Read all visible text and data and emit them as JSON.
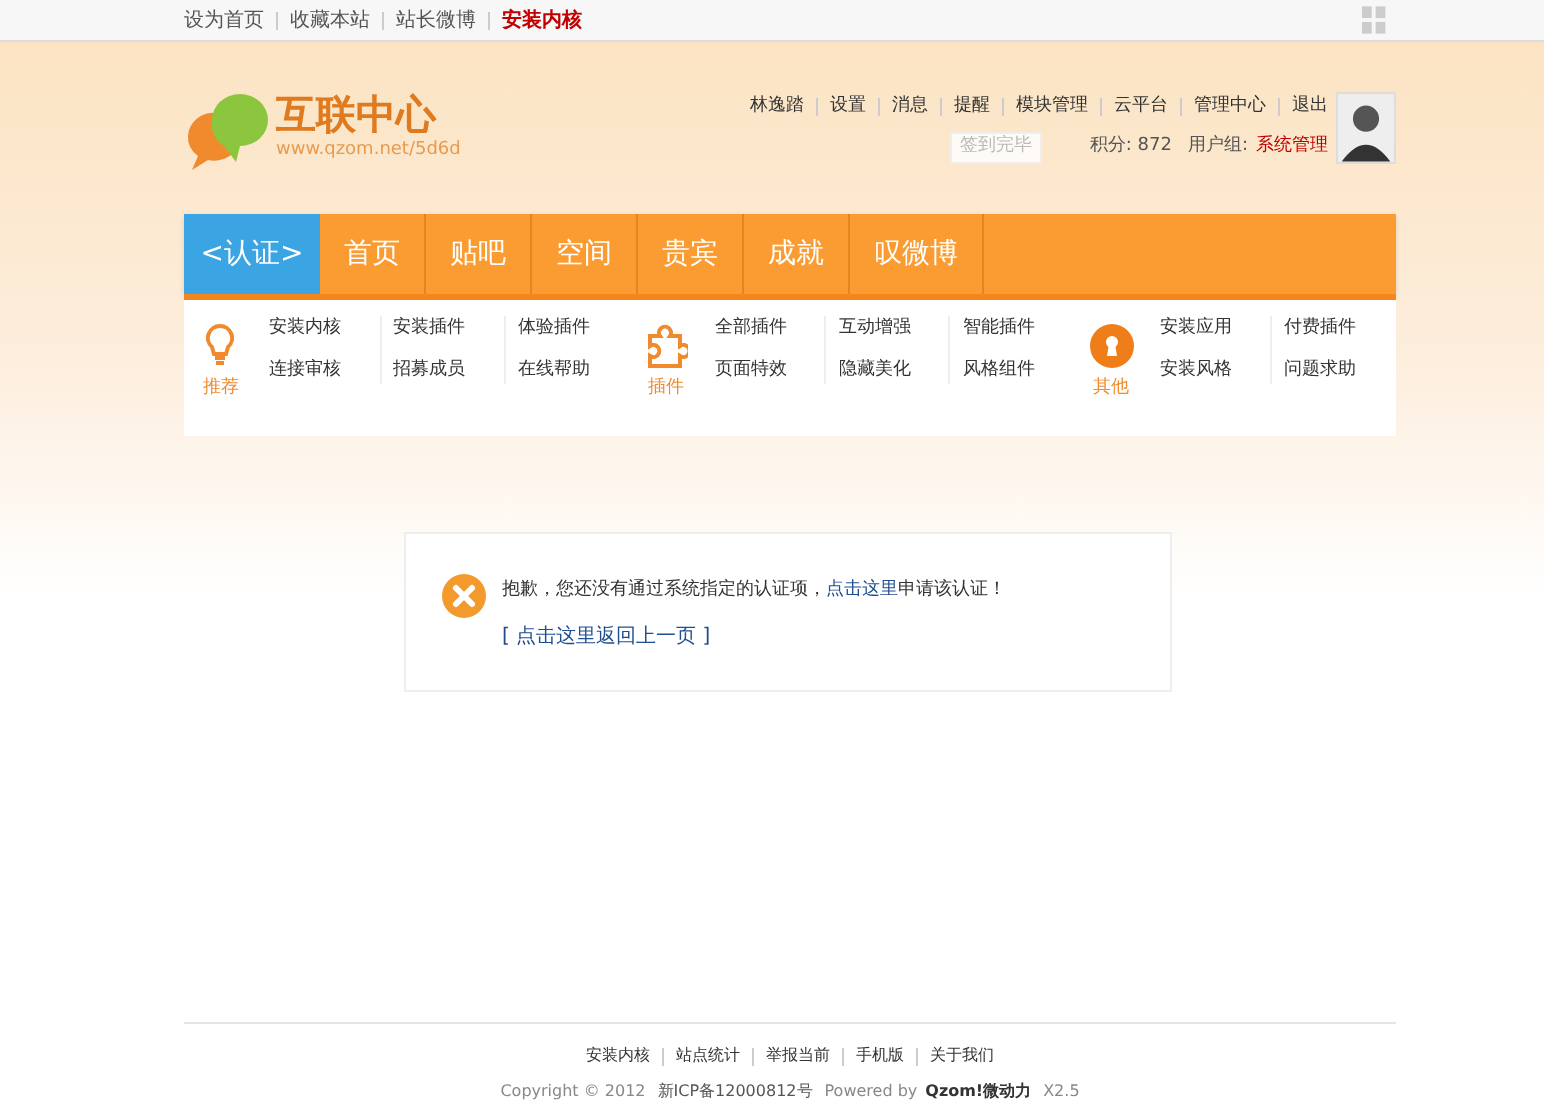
{
  "top_links": [
    {
      "label": "设为首页",
      "highlight": false
    },
    {
      "label": "收藏本站",
      "highlight": false
    },
    {
      "label": "站长微博",
      "highlight": false
    },
    {
      "label": "安装内核",
      "highlight": true
    }
  ],
  "logo": {
    "title": "互联中心",
    "url": "www.qzom.net/5d6d"
  },
  "user_links": [
    "林逸踏",
    "设置",
    "消息",
    "提醒",
    "模块管理",
    "云平台",
    "管理中心",
    "退出"
  ],
  "sign_in": "签到完毕",
  "points": "积分: 872",
  "user_group_label": "用户组:",
  "user_group": "系统管理",
  "tabs": [
    {
      "label": "<认证>",
      "selected": true
    },
    {
      "label": "首页",
      "selected": false
    },
    {
      "label": "贴吧",
      "selected": false
    },
    {
      "label": "空间",
      "selected": false
    },
    {
      "label": "贵宾",
      "selected": false
    },
    {
      "label": "成就",
      "selected": false
    },
    {
      "label": "叹微博",
      "selected": false
    }
  ],
  "menu_groups": [
    {
      "kind": "bulb",
      "label": "推荐",
      "columns": [
        [
          "安装内核",
          "连接审核"
        ],
        [
          "安装插件",
          "招募成员"
        ],
        [
          "体验插件",
          "在线帮助"
        ]
      ]
    },
    {
      "kind": "puzzle",
      "label": "插件",
      "columns": [
        [
          "全部插件",
          "页面特效"
        ],
        [
          "互动增强",
          "隐藏美化"
        ],
        [
          "智能插件",
          "风格组件"
        ]
      ]
    },
    {
      "kind": "keyhole",
      "label": "其他",
      "columns": [
        [
          "安装应用",
          "安装风格"
        ],
        [
          "付费插件",
          "问题求助"
        ]
      ]
    }
  ],
  "message": {
    "before": "抱歉，您还没有通过系统指定的认证项，",
    "link": "点击这里",
    "after": "申请该认证！",
    "back": "[ 点击这里返回上一页 ]"
  },
  "footer_links": [
    "安装内核",
    "站点统计",
    "举报当前",
    "手机版",
    "关于我们"
  ],
  "copyright": {
    "text": "Copyright © 2012",
    "icp": "新ICP备12000812号",
    "powered": "Powered by",
    "brand": "Qzom!微动力",
    "version": "X2.5"
  }
}
